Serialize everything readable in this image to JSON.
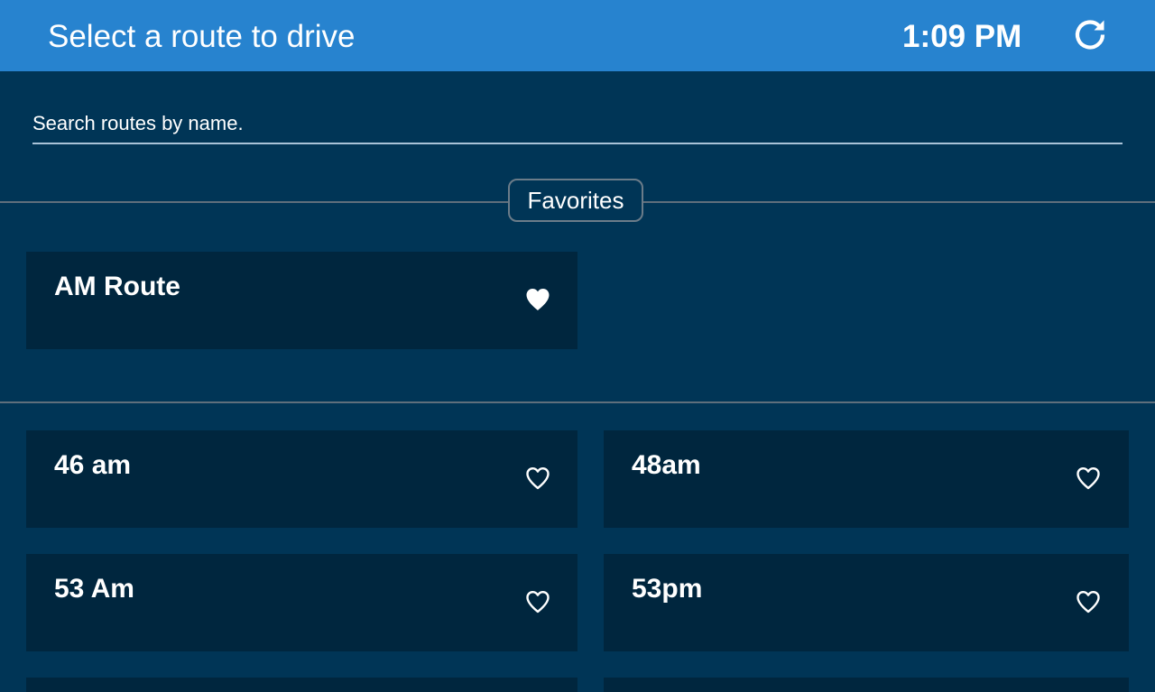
{
  "header": {
    "title": "Select a route to drive",
    "time": "1:09 PM",
    "refresh_icon": "refresh-icon"
  },
  "search": {
    "placeholder": "Search routes by name.",
    "value": ""
  },
  "favorites": {
    "label": "Favorites",
    "routes": [
      {
        "name": "AM Route",
        "favorited": true
      }
    ]
  },
  "routes": [
    {
      "name": "46 am",
      "favorited": false
    },
    {
      "name": "48am",
      "favorited": false
    },
    {
      "name": "53 Am",
      "favorited": false
    },
    {
      "name": "53pm",
      "favorited": false
    },
    {
      "name": "",
      "favorited": false
    },
    {
      "name": "",
      "favorited": false
    }
  ],
  "colors": {
    "header": "#2783cf",
    "background": "#003556",
    "card": "#00263e",
    "divider": "#5f6f7c"
  }
}
